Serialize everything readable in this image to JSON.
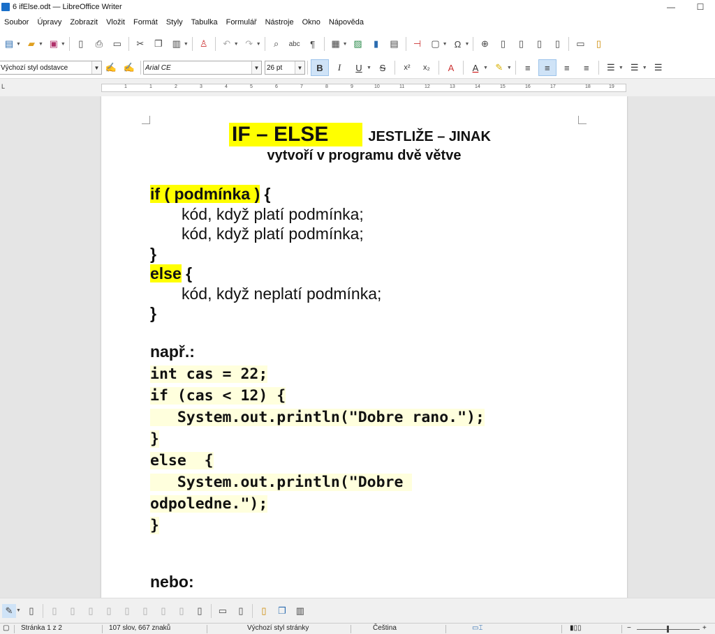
{
  "window": {
    "title": "6 ifElse.odt — LibreOffice Writer",
    "minimize": "—",
    "maximize": "☐"
  },
  "menu": [
    "Soubor",
    "Úpravy",
    "Zobrazit",
    "Vložit",
    "Formát",
    "Styly",
    "Tabulka",
    "Formulář",
    "Nástroje",
    "Okno",
    "Nápověda"
  ],
  "format_toolbar": {
    "paragraph_style": "Výchozí styl odstavce",
    "font_name": "Arial CE",
    "font_size": "26 pt",
    "bold": "B",
    "italic": "I",
    "underline": "U",
    "strike": "S",
    "superscript": "x²",
    "subscript": "x₂"
  },
  "ruler": {
    "ticks": [
      "1",
      "1",
      "2",
      "3",
      "4",
      "5",
      "6",
      "7",
      "8",
      "9",
      "10",
      "11",
      "12",
      "13",
      "14",
      "15",
      "16",
      "17",
      "18",
      "19"
    ]
  },
  "document": {
    "title_main": "IF – ELSE",
    "title_sub": "JESTLIŽE – JINAK",
    "subtitle": "vytvoří v programu dvě větve",
    "syntax": {
      "if_line": "if ( podmínka )",
      "brace_open": " {",
      "body1": "kód, když platí podmínka;",
      "body2": "kód, když platí podmínka;",
      "brace_close": "}",
      "else_kw": "else",
      "else_brace": " {",
      "else_body": "kód, když neplatí podmínka;",
      "brace_close2": "}"
    },
    "example_label": "např.:",
    "code": [
      "int cas = 22;",
      "if (cas < 12) {",
      "   System.out.println(\"Dobre rano.\");",
      "}",
      "else  {",
      "   System.out.println(\"Dobre ",
      "odpoledne.\");",
      "}"
    ],
    "or_label": "nebo:"
  },
  "statusbar": {
    "page": "Stránka 1 z 2",
    "words": "107 slov, 667 znaků",
    "page_style": "Výchozí styl stránky",
    "language": "Čeština"
  }
}
